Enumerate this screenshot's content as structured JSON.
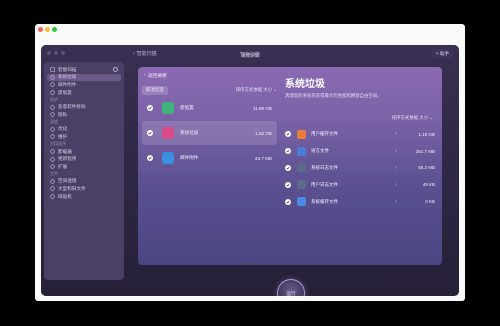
{
  "window": {
    "back_label": "智能扫描",
    "title": "智能扫描",
    "help_label": "助手"
  },
  "sidebar": {
    "top_item": "智能扫描",
    "groups": [
      {
        "header": "",
        "items": [
          {
            "label": "系统垃圾",
            "icon": "trash-icon",
            "active": true
          },
          {
            "label": "邮件附件",
            "icon": "mail-icon"
          },
          {
            "label": "废纸篓",
            "icon": "bin-icon"
          }
        ]
      },
      {
        "header": "保护",
        "items": [
          {
            "label": "恶意软件移除",
            "icon": "shield-icon"
          },
          {
            "label": "隐私",
            "icon": "hand-icon"
          }
        ]
      },
      {
        "header": "速度",
        "items": [
          {
            "label": "优化",
            "icon": "sliders-icon"
          },
          {
            "label": "维护",
            "icon": "wrench-icon"
          }
        ]
      },
      {
        "header": "应用程序",
        "items": [
          {
            "label": "卸载器",
            "icon": "uninstall-icon"
          },
          {
            "label": "更新程序",
            "icon": "update-icon"
          },
          {
            "label": "扩展",
            "icon": "extension-icon"
          }
        ]
      },
      {
        "header": "文件",
        "items": [
          {
            "label": "空间透镜",
            "icon": "lens-icon"
          },
          {
            "label": "大型和旧文件",
            "icon": "folder-icon"
          },
          {
            "label": "碎纸机",
            "icon": "shredder-icon"
          }
        ]
      }
    ]
  },
  "main": {
    "crumb_label": "返回摘要",
    "deselect_all": "取消全选",
    "sort_label": "排序方式依据 大小 ⌄",
    "list": [
      {
        "name": "废纸篓",
        "size": "11.96 GB",
        "color": "#3fb27a",
        "selected": false
      },
      {
        "name": "系统垃圾",
        "size": "1.62 GB",
        "color": "#d94a8a",
        "selected": true
      },
      {
        "name": "邮件附件",
        "size": "43.7 MB",
        "color": "#3a8fe0",
        "selected": false
      }
    ],
    "detail": {
      "header_label": "清理详情",
      "title": "系统垃圾",
      "description": "清理您的系统来获得最大的性能和释放自由空间。",
      "sort_label": "排序方式依据 大小 ⌄",
      "rows": [
        {
          "name": "用户缓存文件",
          "size": "1.18 GB",
          "color": "#e87a3a"
        },
        {
          "name": "语言文件",
          "size": "381.7 MB",
          "color": "#4a7cd8"
        },
        {
          "name": "系统日志文件",
          "size": "55.2 MB",
          "color": "#5a6a88"
        },
        {
          "name": "用户日志文件",
          "size": "49 KB",
          "color": "#5a6a88"
        },
        {
          "name": "系统缓存文件",
          "size": "0 KB",
          "color": "#4a8ae0"
        }
      ]
    }
  },
  "run_button": "运行"
}
